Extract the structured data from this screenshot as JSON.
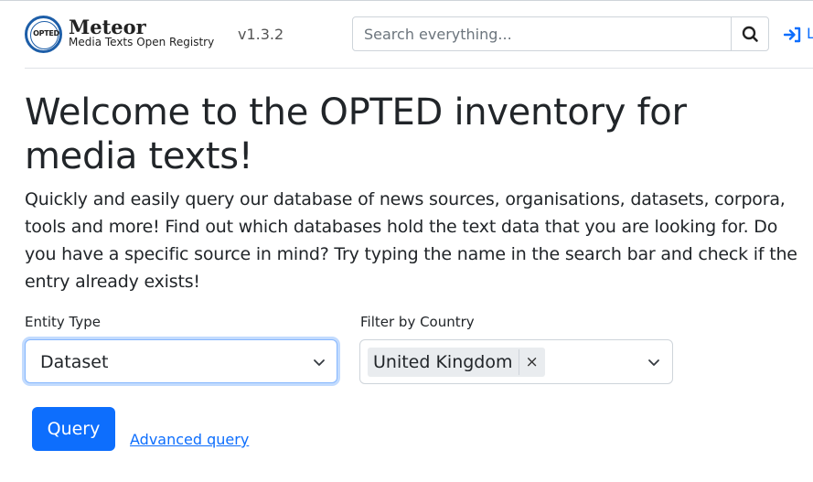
{
  "header": {
    "logo_text": "OPTED",
    "brand_name": "Meteor",
    "brand_subtitle": "Media Texts Open Registry",
    "version": "v1.3.2",
    "search": {
      "placeholder": "Search everything...",
      "value": ""
    },
    "login_label": "L"
  },
  "main": {
    "title": "Welcome to the OPTED inventory for media texts!",
    "intro": "Quickly and easily query our database of news sources, organisations, datasets, corpora, tools and more! Find out which databases hold the text data that you are looking for. Do you have a specific source in mind? Try typing the name in the search bar and check if the entry already exists!",
    "entity_type": {
      "label": "Entity Type",
      "value": "Dataset"
    },
    "country_filter": {
      "label": "Filter by Country",
      "selected": [
        "United Kingdom"
      ],
      "remove_symbol": "×"
    },
    "query_button": "Query",
    "advanced_link": "Advanced query"
  },
  "colors": {
    "primary": "#0d6efd",
    "logo_ring": "#1d5ea8",
    "text": "#212529"
  },
  "icons": {
    "search": "search-icon",
    "login": "sign-in-icon",
    "dropdown": "chevron-down-icon",
    "remove": "close-icon"
  }
}
